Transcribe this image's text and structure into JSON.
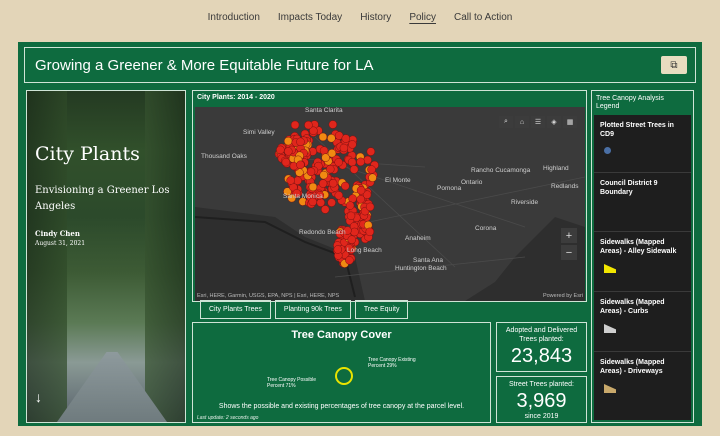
{
  "nav": [
    "Introduction",
    "Impacts Today",
    "History",
    "Policy",
    "Call to Action"
  ],
  "nav_active": "Policy",
  "header": {
    "title": "Growing a Greener & More Equitable Future for LA"
  },
  "story": {
    "title": "City Plants",
    "subtitle": "Envisioning a Greener Los Angeles",
    "author": "Cindy Chen",
    "date": "August 31, 2021"
  },
  "map": {
    "title": "City Plants: 2014 - 2020",
    "attribution": "Esri, HERE, Garmin, USGS, EPA, NPS | Esri, HERE, NPS",
    "powered": "Powered by Esri",
    "places": [
      "Santa Clarita",
      "Simi Valley",
      "Thousand Oaks",
      "Santa Monica",
      "El Monte",
      "Rancho Cucamonga",
      "Ontario",
      "Pomona",
      "Highland",
      "Redlands",
      "Riverside",
      "Corona",
      "Anaheim",
      "Redondo Beach",
      "Long Beach",
      "Santa Ana",
      "Huntington Beach"
    ]
  },
  "map_tabs": [
    "City Plants Trees",
    "Planting 90k Trees",
    "Tree Equity"
  ],
  "canopy": {
    "title": "Tree Canopy Cover",
    "existing_label": "Tree Canopy Existing Percent 29%",
    "possible_label": "Tree Canopy Possible Percent 71%",
    "description": "Shows the possible and existing percentages of tree canopy at the parcel level.",
    "updated": "Last update: 2 seconds ago",
    "existing_percent": 29,
    "possible_percent": 71
  },
  "cards": {
    "adopted_label": "Adopted and Delivered Trees planted:",
    "adopted_value": "23,843",
    "street_label": "Street Trees planted:",
    "street_value": "3,969",
    "street_since": "since 2019"
  },
  "legend": {
    "title": "Tree Canopy Analysis Legend",
    "items": [
      "Plotted Street Trees in CD9",
      "Council District 9 Boundary",
      "Sidewalks (Mapped Areas) - Alley Sidewalk",
      "Sidewalks (Mapped Areas) - Curbs",
      "Sidewalks (Mapped Areas) - Driveways"
    ],
    "colors": [
      "#4a6fa5",
      "#1e1e1e",
      "#f2e600",
      "#cfcfcf",
      "#c9a96b"
    ]
  },
  "colors": {
    "panel": "#0e6b3f",
    "background": "#e3d5b8",
    "marker": "#e0261c",
    "marker_alt": "#f08a12"
  }
}
